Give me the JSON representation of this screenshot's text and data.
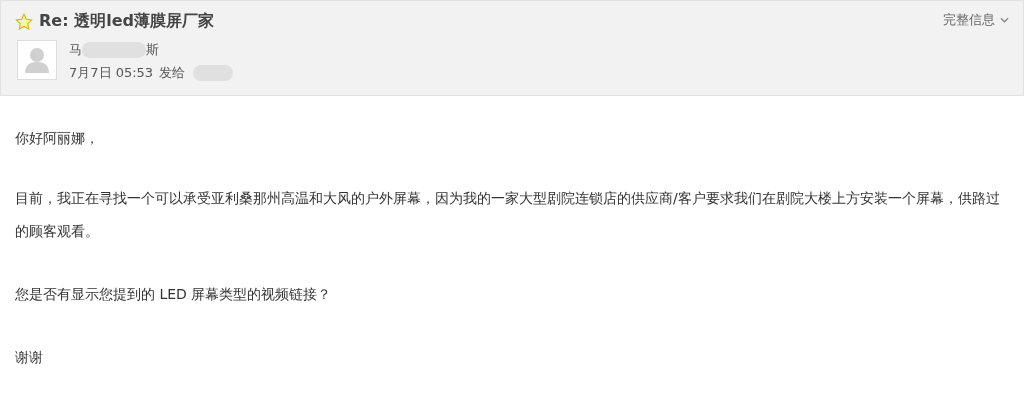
{
  "header": {
    "starred": false,
    "title": "Re: 透明led薄膜屏厂家",
    "details_toggle": "完整信息",
    "sender_start": "马",
    "sender_end": "斯",
    "time": "7月7日 05:53",
    "sent_to": "发给"
  },
  "body": {
    "paragraphs": [
      "你好阿丽娜，",
      "目前，我正在寻找一个可以承受亚利桑那州高温和大风的户外屏幕，因为我的一家大型剧院连锁店的供应商/客户要求我们在剧院大楼上方安装一个屏幕，供路过的顾客观看。",
      "您是否有显示您提到的 LED 屏幕类型的视频链接？",
      "谢谢"
    ]
  }
}
